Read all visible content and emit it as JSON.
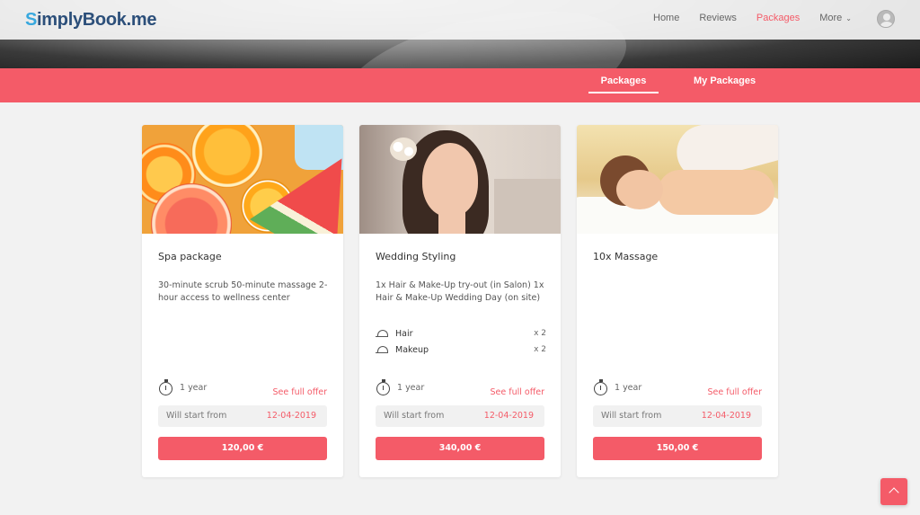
{
  "header": {
    "logo_s": "S",
    "logo_rest": "implyBook.me",
    "nav": [
      {
        "label": "Home"
      },
      {
        "label": "Reviews"
      },
      {
        "label": "Packages"
      },
      {
        "label": "More"
      }
    ]
  },
  "tabs": {
    "packages": "Packages",
    "my_packages": "My Packages"
  },
  "cards": [
    {
      "title": "Spa package",
      "description": "30-minute scrub 50-minute massage 2-hour access to wellness center",
      "validity": "1 year",
      "full_offer": "See full offer",
      "start_label": "Will start from",
      "start_date": "12-04-2019",
      "price": "120,00 €",
      "image": "fruit-image"
    },
    {
      "title": "Wedding Styling",
      "description": "1x Hair & Make-Up try-out (in Salon) 1x Hair & Make-Up Wedding Day (on site)",
      "services": [
        {
          "name": "Hair",
          "qty": "x 2"
        },
        {
          "name": "Makeup",
          "qty": "x 2"
        }
      ],
      "validity": "1 year",
      "full_offer": "See full offer",
      "start_label": "Will start from",
      "start_date": "12-04-2019",
      "price": "340,00 €",
      "image": "bride-image"
    },
    {
      "title": "10x Massage",
      "description": "",
      "validity": "1 year",
      "full_offer": "See full offer",
      "start_label": "Will start from",
      "start_date": "12-04-2019",
      "price": "150,00 €",
      "image": "massage-image"
    }
  ],
  "icons": {
    "service": "bell-icon",
    "validity": "stopwatch-icon",
    "user": "user-avatar-icon",
    "scroll_top": "chevron-up-icon"
  },
  "colors": {
    "accent": "#f45b68",
    "logo_blue": "#38a8de",
    "logo_navy": "#2c4f7a",
    "background": "#f2f2f2"
  }
}
